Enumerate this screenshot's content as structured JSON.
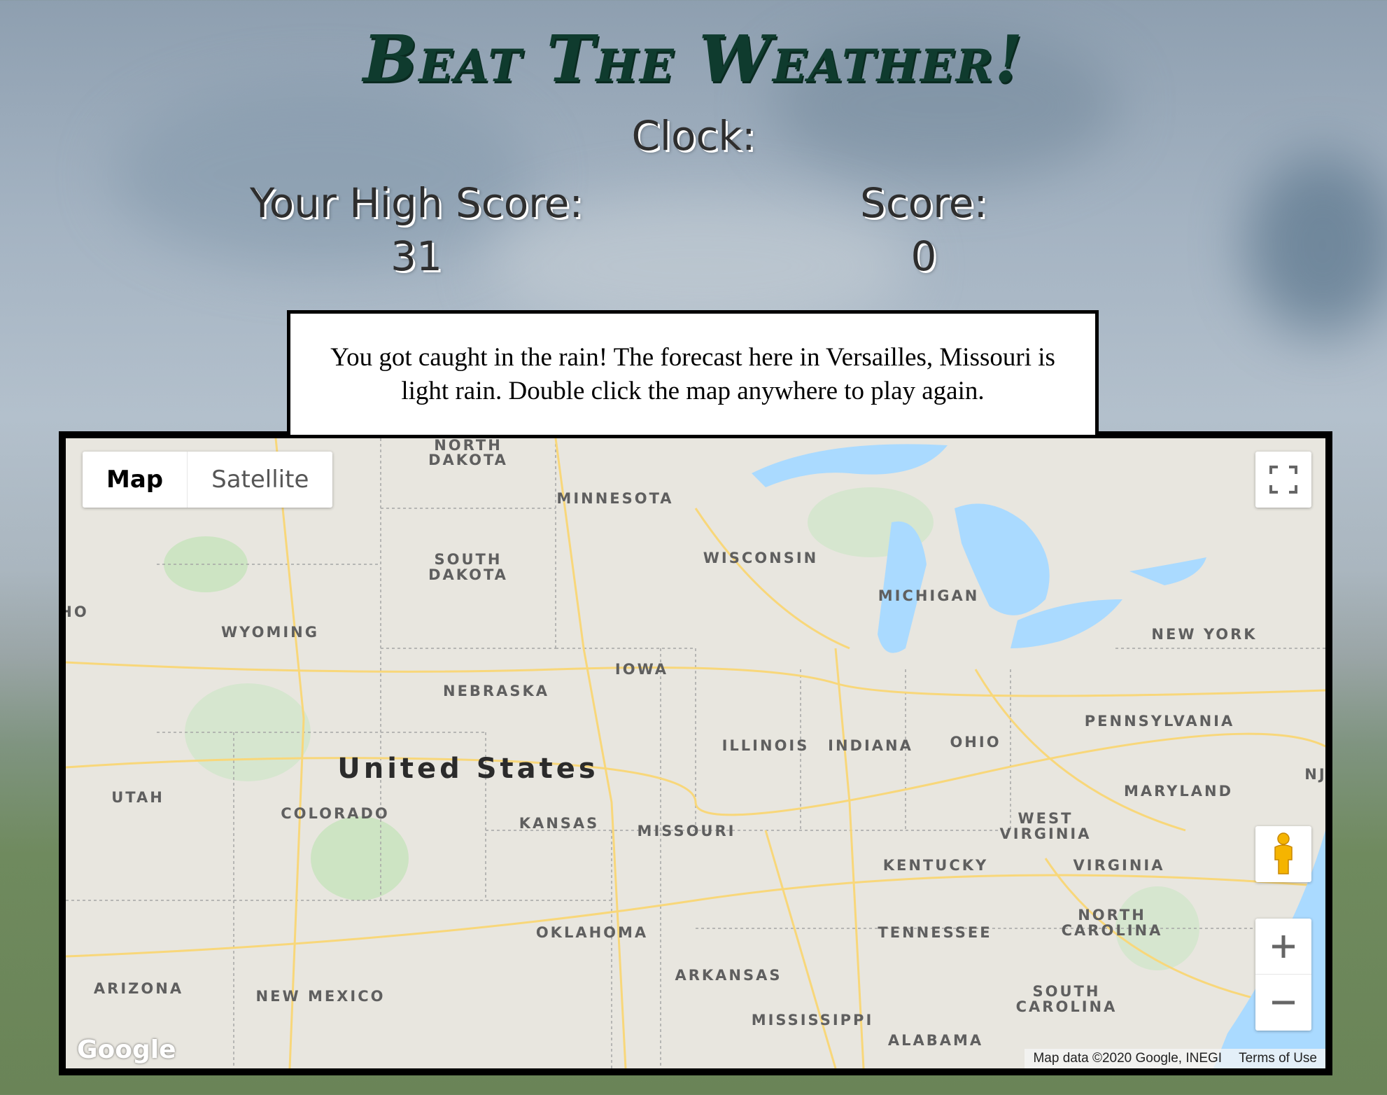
{
  "header": {
    "title": "Beat The Weather!",
    "clock_label": "Clock:",
    "high_score_label": "Your High Score:",
    "high_score_value": "31",
    "score_label": "Score:",
    "score_value": "0"
  },
  "message": "You got caught in the rain! The forecast here in Versailles, Missouri is light rain. Double click the map anywhere to play again.",
  "map": {
    "map_type_buttons": [
      "Map",
      "Satellite"
    ],
    "selected_type": "Map",
    "country_label": "United States",
    "state_labels": {
      "north_dakota": [
        "NORTH",
        "DAKOTA"
      ],
      "minnesota": "MINNESOTA",
      "south_dakota": [
        "SOUTH",
        "DAKOTA"
      ],
      "wisconsin": "WISCONSIN",
      "michigan": "MICHIGAN",
      "idaho_partial": "HO",
      "wyoming": "WYOMING",
      "new_york": "NEW YORK",
      "iowa": "IOWA",
      "nebraska": "NEBRASKA",
      "pennsylvania": "PENNSYLVANIA",
      "illinois": "ILLINOIS",
      "indiana": "INDIANA",
      "ohio": "OHIO",
      "new_jersey_partial": "NJ",
      "maryland": "MARYLAND",
      "utah": "UTAH",
      "colorado": "COLORADO",
      "kansas": "KANSAS",
      "missouri": "MISSOURI",
      "west_virginia": [
        "WEST",
        "VIRGINIA"
      ],
      "kentucky": "KENTUCKY",
      "virginia": "VIRGINIA",
      "oklahoma": "OKLAHOMA",
      "tennessee": "TENNESSEE",
      "north_carolina": [
        "NORTH",
        "CAROLINA"
      ],
      "arizona": "ARIZONA",
      "new_mexico": "NEW MEXICO",
      "arkansas": "ARKANSAS",
      "south_carolina": [
        "SOUTH",
        "CAROLINA"
      ],
      "mississippi": "MISSISSIPPI",
      "alabama": "ALABAMA"
    },
    "logo": "Google",
    "attribution": "Map data ©2020 Google, INEGI",
    "terms": "Terms of Use",
    "controls": [
      "fullscreen-icon",
      "pegman-icon",
      "zoom-in-icon",
      "zoom-out-icon"
    ]
  },
  "colors": {
    "title": "#0f3b2e",
    "water": "#aadaff",
    "land": "#e8e6df",
    "roads": "#f8d77a"
  }
}
